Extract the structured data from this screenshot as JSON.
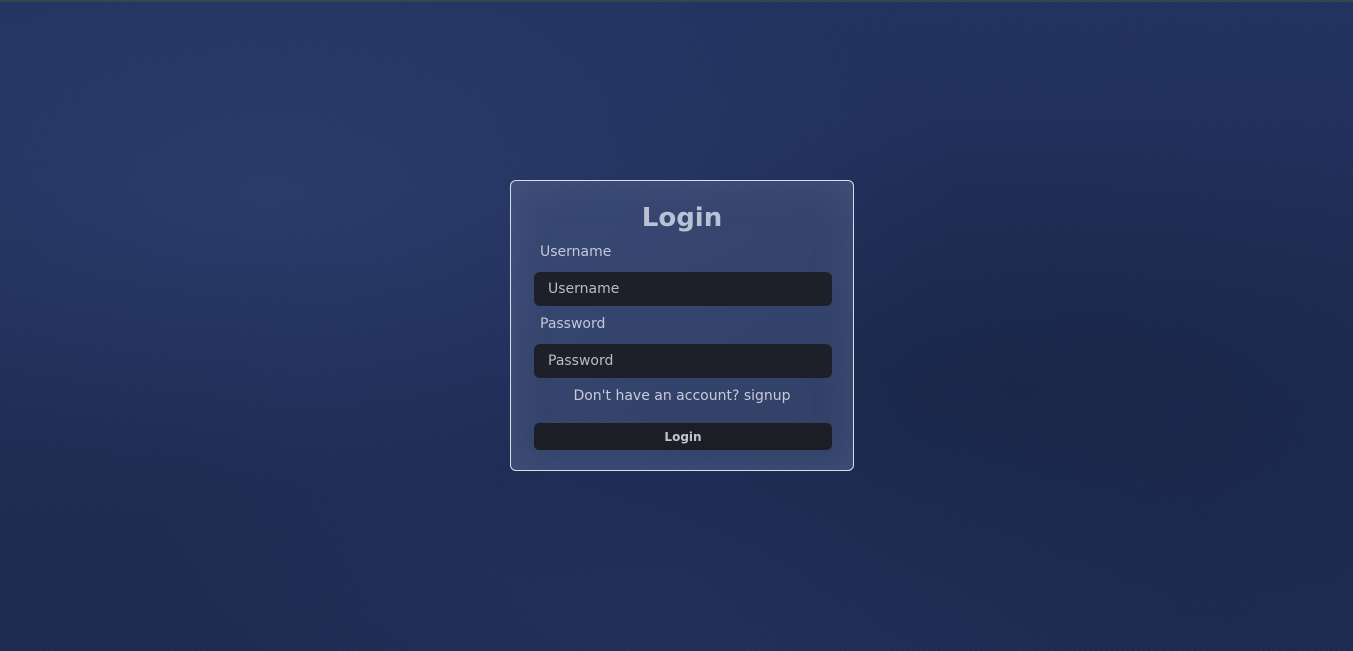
{
  "page": {
    "background_color": "#1f2f57"
  },
  "login_form": {
    "title": "Login",
    "username_label": "Username",
    "username_placeholder": "Username",
    "username_value": "",
    "password_label": "Password",
    "password_placeholder": "Password",
    "password_value": "",
    "signup_prompt": "Don't have an account?",
    "signup_link": "signup",
    "submit_label": "Login",
    "colors": {
      "input_bg": "#1d2029",
      "button_bg": "#1b1e25",
      "card_border": "#d9dde6"
    }
  }
}
